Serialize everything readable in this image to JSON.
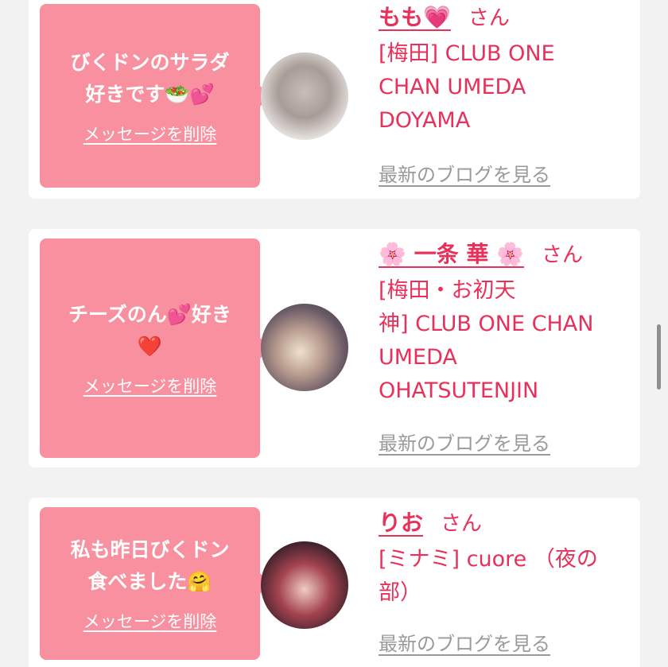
{
  "cards": [
    {
      "message": "びくドンのサラダ\n好きです🥗💕",
      "delete_label": "メッセージを削除",
      "name": "もも💗",
      "suffix": "さん",
      "shop": "[梅田] CLUB ONE\nCHAN UMEDA\nDOYAMA",
      "blog_link": "最新のブログを見る"
    },
    {
      "message": "チーズのん💕好き\n❤️",
      "delete_label": "メッセージを削除",
      "name": "🌸 一条 華 🌸",
      "suffix": "さん",
      "shop": "[梅田・お初天\n神] CLUB ONE CHAN\nUMEDA\nOHATSUTENJIN",
      "blog_link": "最新のブログを見る"
    },
    {
      "message": "私も昨日びくドン\n食べました🤗",
      "delete_label": "メッセージを削除",
      "name": "りお",
      "suffix": "さん",
      "shop": "[ミナミ] cuore （夜の\n部）",
      "blog_link": "最新のブログを見る"
    }
  ]
}
